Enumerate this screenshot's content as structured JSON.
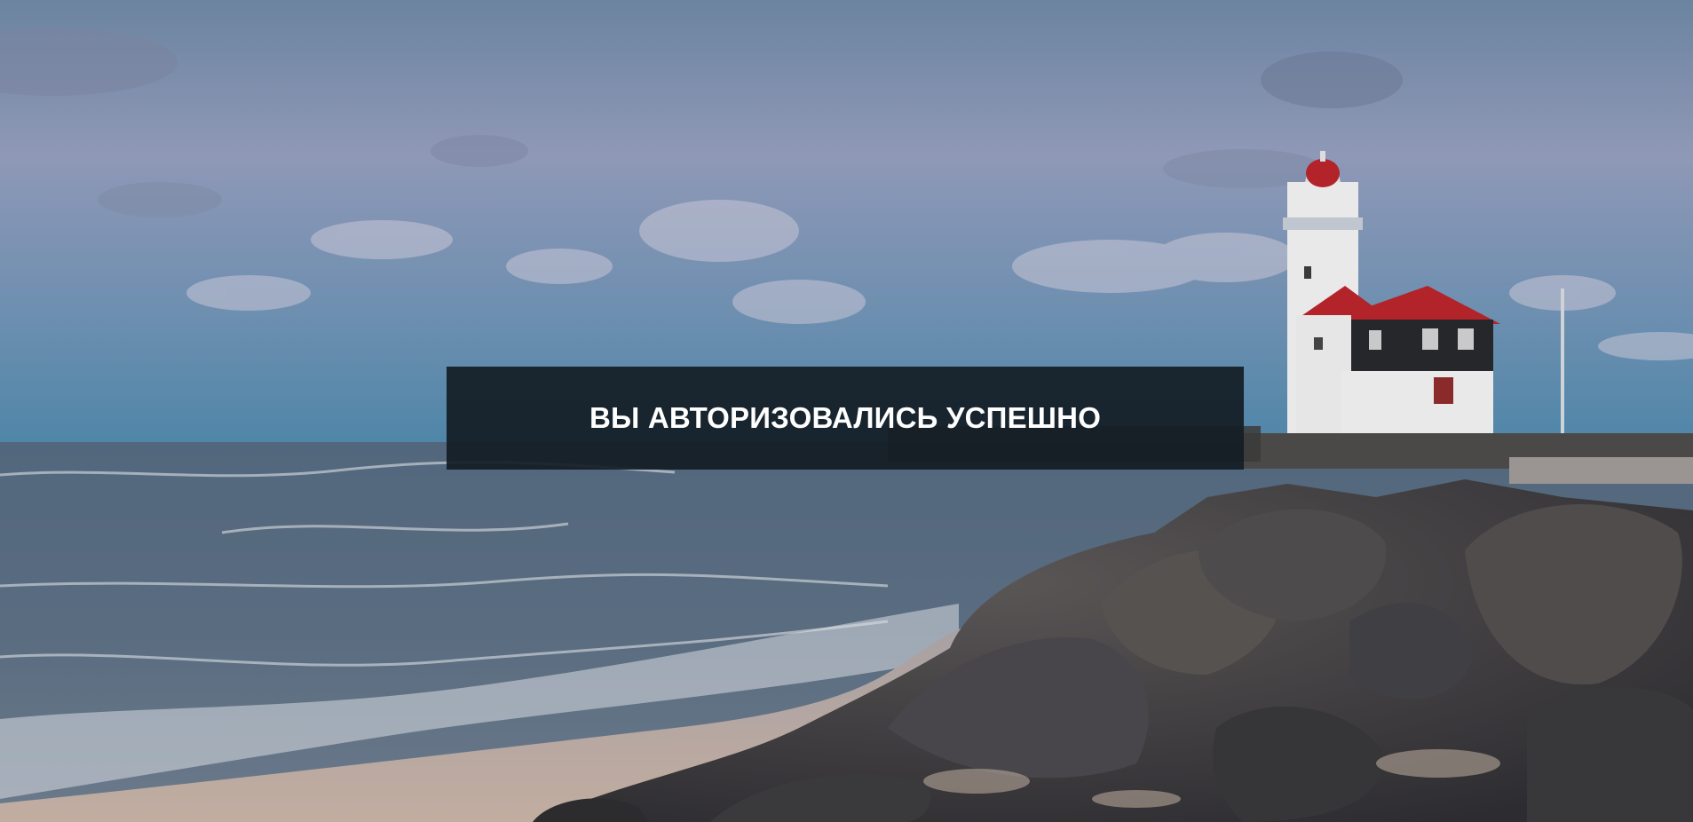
{
  "notification": {
    "message": "ВЫ АВТОРИЗОВАЛИСЬ УСПЕШНО"
  },
  "background": {
    "subject": "coastal lighthouse at dusk with rocky shore and sea waves",
    "colors": {
      "sky_top": "#6d86a3",
      "sky_mid": "#8e9ab8",
      "sky_horizon": "#5e89a8",
      "sea": "#4f6175",
      "sand": "#b7a99c",
      "rocks": "#3d3c3f",
      "lighthouse_white": "#ececec",
      "roof_red": "#b3232a",
      "house_dark": "#26272b"
    }
  },
  "overlay": {
    "color": "#141c24"
  }
}
